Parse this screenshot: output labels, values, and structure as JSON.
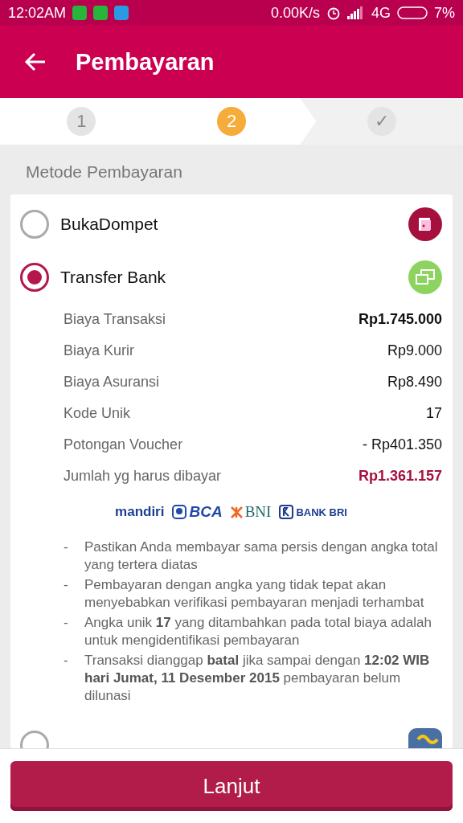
{
  "status_bar": {
    "time": "12:02AM",
    "notifications": [
      {
        "kind": "chat"
      },
      {
        "kind": "chat"
      },
      {
        "kind": "drop"
      }
    ],
    "speed": "0.00K/s",
    "network": "4G",
    "battery": "7%"
  },
  "app_bar": {
    "title": "Pembayaran"
  },
  "steps": [
    {
      "label": "1",
      "selected": false
    },
    {
      "label": "2",
      "selected": true
    },
    {
      "label": "✓",
      "selected": false
    }
  ],
  "section_title": "Metode Pembayaran",
  "methods": [
    {
      "label": "BukaDompet",
      "selected": false,
      "kind": "wallet"
    },
    {
      "label": "Transfer Bank",
      "selected": true,
      "kind": "transfer"
    },
    {
      "selected": false,
      "kind": "card"
    }
  ],
  "details": [
    {
      "label": "Biaya Transaksi",
      "value": "Rp1.745.000",
      "kind": "bold"
    },
    {
      "label": "Biaya Kurir",
      "value": "Rp9.000",
      "kind": "plain"
    },
    {
      "label": "Biaya Asuransi",
      "value": "Rp8.490",
      "kind": "plain"
    },
    {
      "label": "Kode Unik",
      "value": "17",
      "kind": "plain"
    },
    {
      "label": "Potongan Voucher",
      "value": "- Rp401.350",
      "kind": "plain"
    },
    {
      "label": "Jumlah yg harus dibayar",
      "value": "Rp1.361.157",
      "kind": "total"
    }
  ],
  "banks": [
    {
      "name": "mandiri",
      "kind": "mandiri"
    },
    {
      "name": "BCA",
      "kind": "bca"
    },
    {
      "name": "BNI",
      "kind": "bni"
    },
    {
      "name": "BANK BRI",
      "kind": "bri"
    }
  ],
  "notes": [
    "Pastikan Anda membayar sama persis dengan angka total yang tertera diatas",
    "Pembayaran dengan angka yang tidak tepat akan menyebabkan verifikasi pembayaran menjadi terhambat",
    "Angka unik **17** yang ditambahkan pada total biaya adalah untuk mengidentifikasi pembayaran",
    "Transaksi dianggap **batal** jika sampai dengan **12:02 WIB hari Jumat, 11 Desember 2015** pembayaran belum dilunasi"
  ],
  "note_marker": "-",
  "button": "Lanjut"
}
